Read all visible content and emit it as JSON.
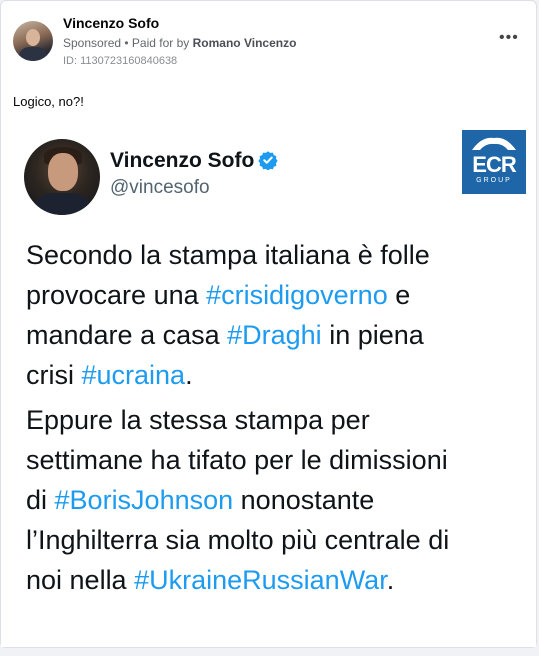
{
  "ad": {
    "advertiser_name": "Vincenzo Sofo",
    "sponsored_label": "Sponsored",
    "separator": " • ",
    "paid_for_prefix": "Paid for by ",
    "payer_name": "Romano Vincenzo",
    "id_text": "ID: 1130723160840638",
    "more_label": "•••",
    "body_text": "Logico, no?!"
  },
  "tweet": {
    "author_name": "Vincenzo Sofo",
    "handle": "@vincesofo",
    "logo_text": "ECR",
    "logo_subtext": "GROUP",
    "para1": {
      "l1": "Secondo la stampa italiana è folle",
      "l2a": "provocare una ",
      "l2tag": "#crisidigoverno",
      "l2b": " e",
      "l3a": "mandare a casa ",
      "l3tag": "#Draghi",
      "l3b": " in piena",
      "l4a": "crisi ",
      "l4tag": "#ucraina",
      "l4b": "."
    },
    "para2": {
      "l1": "Eppure la stessa stampa per",
      "l2": "settimane ha tifato per le dimissioni",
      "l3a": "di ",
      "l3tag": "#BorisJohnson",
      "l3b": " nonostante",
      "l4": "l’Inghilterra sia molto più centrale di",
      "l5a": "noi nella ",
      "l5tag": "#UkraineRussianWar",
      "l5b": "."
    }
  },
  "colors": {
    "hashtag": "#1d9bf0",
    "verified_badge": "#1d9bf0",
    "ecr_logo": "#1e66a8"
  },
  "icons": [
    "more-options-icon",
    "verified-badge-icon",
    "ecr-logo"
  ]
}
